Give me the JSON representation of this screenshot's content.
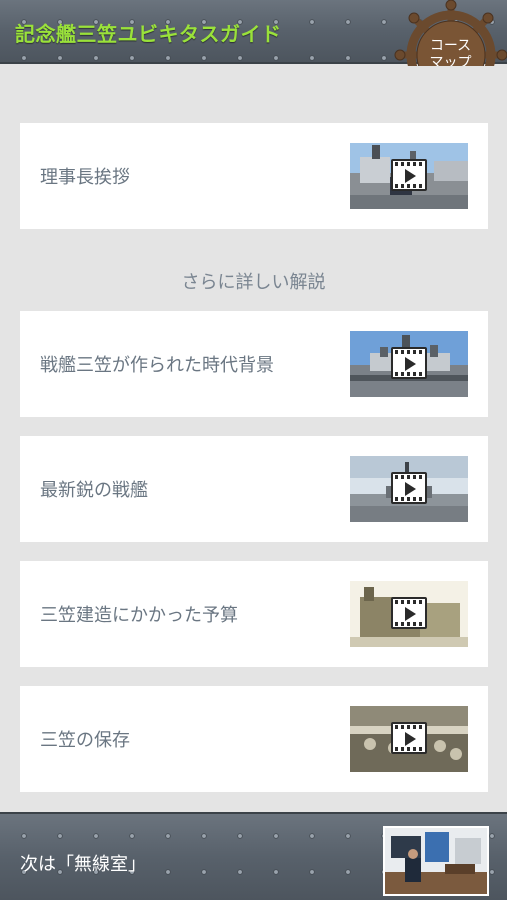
{
  "header": {
    "title": "記念艦三笠ユビキタスガイド",
    "course_map_line1": "コース",
    "course_map_line2": "マップ"
  },
  "intro_item": {
    "label": "理事長挨拶"
  },
  "section_title": "さらに詳しい解説",
  "items": [
    {
      "label": "戦艦三笠が作られた時代背景"
    },
    {
      "label": "最新鋭の戦艦"
    },
    {
      "label": "三笠建造にかかった予算"
    },
    {
      "label": "三笠の保存"
    }
  ],
  "footer": {
    "next_label": "次は「無線室」"
  },
  "colors": {
    "title_green": "#9ae23a",
    "label_gray": "#6a7682",
    "wheel_brown": "#6b4a2e"
  }
}
